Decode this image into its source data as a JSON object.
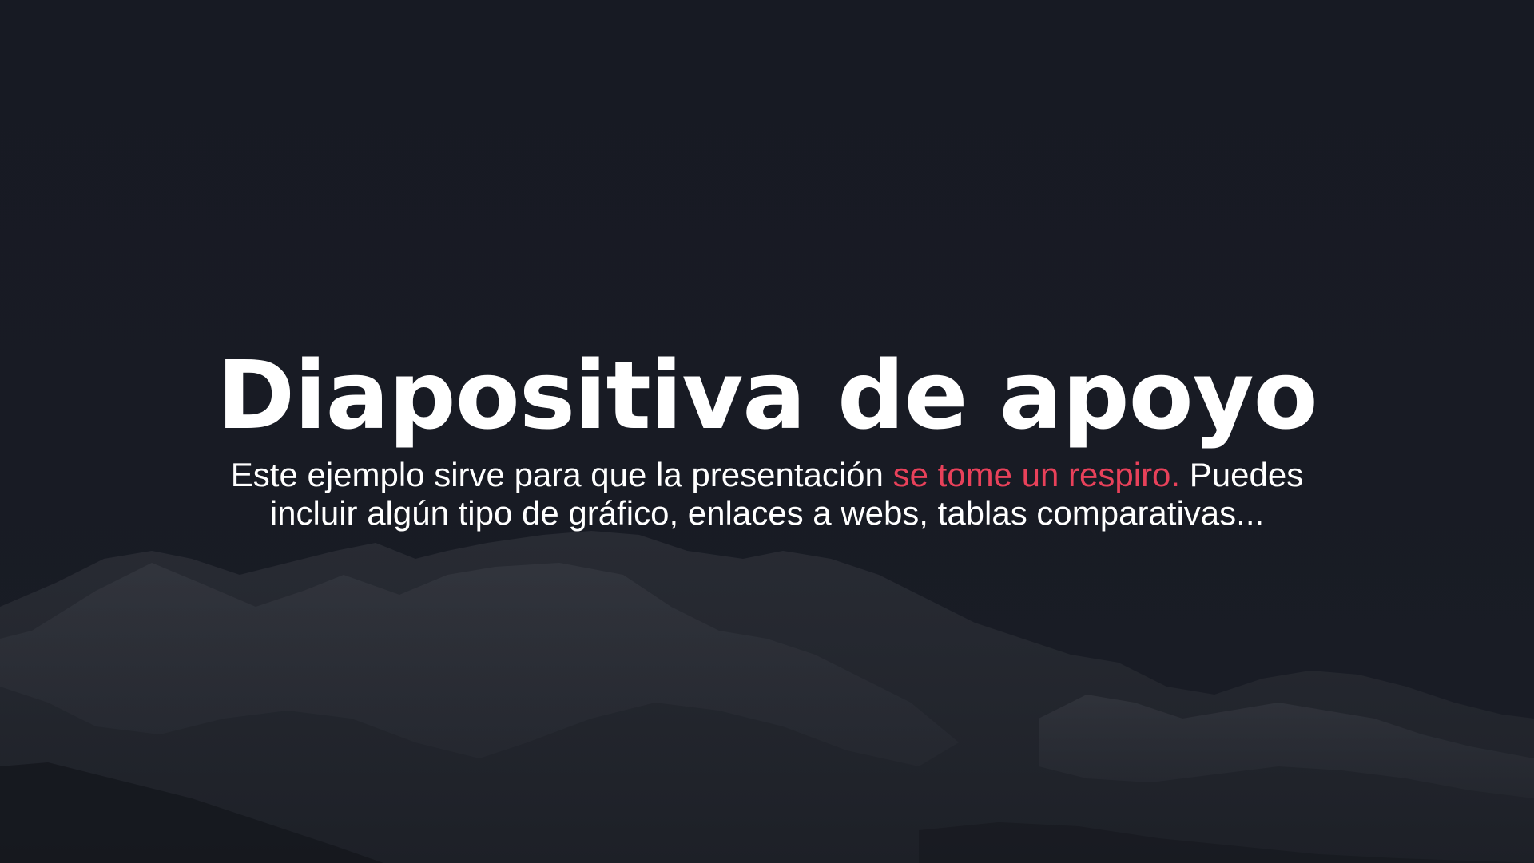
{
  "slide": {
    "title": "Diapositiva de apoyo",
    "subtitle_before": "Este ejemplo sirve para que la presentación ",
    "subtitle_highlight": "se tome un respiro.",
    "subtitle_line1_after": " Puedes",
    "subtitle_line2": "incluir algún tipo de gráfico, enlaces a webs, tablas comparativas...",
    "background_image": "snowy-mountains-photo",
    "colors": {
      "background": "#171a23",
      "text": "#ffffff",
      "accent": "#e8415a"
    }
  }
}
